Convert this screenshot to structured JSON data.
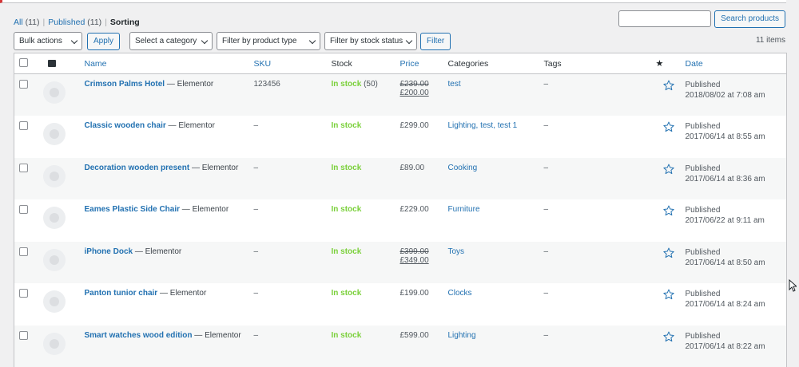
{
  "views": [
    {
      "label": "All",
      "count": "(11)"
    },
    {
      "label": "Published",
      "count": "(11)"
    },
    {
      "label": "Sorting"
    }
  ],
  "search": {
    "button": "Search products",
    "value": ""
  },
  "bulk": {
    "label": "Bulk actions",
    "apply": "Apply"
  },
  "filters": {
    "category": "Select a category",
    "product_type": "Filter by product type",
    "stock_status": "Filter by stock status",
    "button": "Filter"
  },
  "items_count": "11 items",
  "columns": {
    "name": "Name",
    "sku": "SKU",
    "stock": "Stock",
    "price": "Price",
    "categories": "Categories",
    "tags": "Tags",
    "featured_icon": "star-icon",
    "date": "Date"
  },
  "rows": [
    {
      "name": "Crimson Palms Hotel",
      "builder": " — Elementor",
      "sku": "123456",
      "stock": "In stock",
      "stock_qty": " (50)",
      "price_old": "£239.00",
      "price": "£200.00",
      "categories": "test",
      "tags": "–",
      "status": "Published",
      "date": "2018/08/02 at 7:08 am"
    },
    {
      "name": "Classic wooden chair",
      "builder": " — Elementor",
      "sku": "–",
      "stock": "In stock",
      "stock_qty": "",
      "price_old": "",
      "price": "£299.00",
      "categories": "Lighting, test, test 1",
      "tags": "–",
      "status": "Published",
      "date": "2017/06/14 at 8:55 am"
    },
    {
      "name": "Decoration wooden present",
      "builder": " — Elementor",
      "sku": "–",
      "stock": "In stock",
      "stock_qty": "",
      "price_old": "",
      "price": "£89.00",
      "categories": "Cooking",
      "tags": "–",
      "status": "Published",
      "date": "2017/06/14 at 8:36 am"
    },
    {
      "name": "Eames Plastic Side Chair",
      "builder": " — Elementor",
      "sku": "–",
      "stock": "In stock",
      "stock_qty": "",
      "price_old": "",
      "price": "£229.00",
      "categories": "Furniture",
      "tags": "–",
      "status": "Published",
      "date": "2017/06/22 at 9:11 am"
    },
    {
      "name": "iPhone Dock",
      "builder": " — Elementor",
      "sku": "–",
      "stock": "In stock",
      "stock_qty": "",
      "price_old": "£399.00",
      "price": "£349.00",
      "categories": "Toys",
      "tags": "–",
      "status": "Published",
      "date": "2017/06/14 at 8:50 am"
    },
    {
      "name": "Panton tunior chair",
      "builder": " — Elementor",
      "sku": "–",
      "stock": "In stock",
      "stock_qty": "",
      "price_old": "",
      "price": "£199.00",
      "categories": "Clocks",
      "tags": "–",
      "status": "Published",
      "date": "2017/06/14 at 8:24 am"
    },
    {
      "name": "Smart watches wood edition",
      "builder": " — Elementor",
      "sku": "–",
      "stock": "In stock",
      "stock_qty": "",
      "price_old": "",
      "price": "£599.00",
      "categories": "Lighting",
      "tags": "–",
      "status": "Published",
      "date": "2017/06/14 at 8:22 am"
    }
  ],
  "colors": {
    "link": "#2271b1",
    "in_stock": "#7ad03a",
    "border": "#c3c4c7",
    "background": "#f0f0f1",
    "notice": "#d63638"
  }
}
